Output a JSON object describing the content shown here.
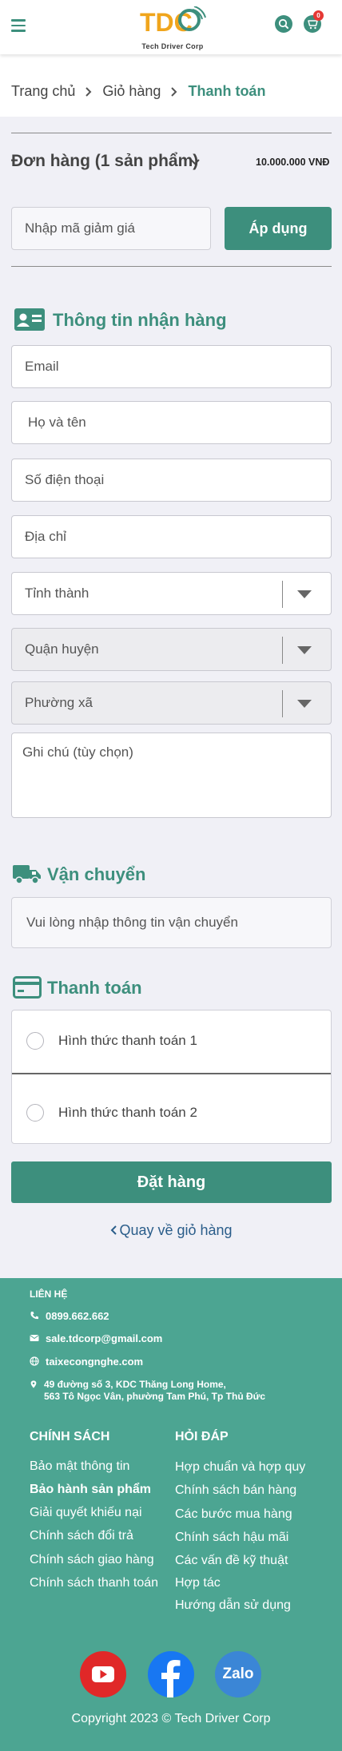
{
  "header": {
    "brand_text": "Tech Driver Corp",
    "logo_letters": "TDC",
    "cart_count": "0"
  },
  "breadcrumb": {
    "home": "Trang chủ",
    "cart": "Giỏ hàng",
    "current": "Thanh toán"
  },
  "order": {
    "title": "Đơn hàng (1 sản phẩm)",
    "total": "10.000.000 VNĐ"
  },
  "coupon": {
    "placeholder": "Nhập mã giảm giá",
    "apply_label": "Áp dụng"
  },
  "shipping_info": {
    "title": "Thông tin nhận hàng",
    "email_placeholder": "Email",
    "name_placeholder": "Họ và tên",
    "phone_placeholder": "Số điện thoại",
    "address_placeholder": "Địa chỉ",
    "province_placeholder": "Tỉnh thành",
    "district_placeholder": "Quận huyện",
    "ward_placeholder": "Phường xã",
    "note_placeholder": "Ghi chú (tùy chọn)"
  },
  "delivery": {
    "title": "Vận chuyển",
    "message": "Vui lòng nhập thông tin vận chuyển"
  },
  "payment": {
    "title": "Thanh toán",
    "options": [
      "Hình thức thanh toán 1",
      "Hình thức thanh toán 2"
    ]
  },
  "actions": {
    "place_order": "Đặt hàng",
    "back_to_cart": "Quay về giỏ hàng"
  },
  "footer": {
    "contact_title": "LIÊN HỆ",
    "phone": "0899.662.662",
    "email": "sale.tdcorp@gmail.com",
    "website": "taixecongnghe.com",
    "address_line1": "49 đường số 3, KDC Thăng Long Home,",
    "address_line2": "563 Tô Ngọc Vân, phường Tam Phú, Tp Thủ Đức",
    "policy_title": "CHÍNH SÁCH",
    "policy_links": [
      "Bảo mật thông tin",
      "Bảo hành sản phẩm",
      "Giải quyết khiếu nại",
      "Chính sách đổi trả",
      "Chính sách giao hàng",
      "Chính sách thanh toán"
    ],
    "faq_title": "HỎI ĐÁP",
    "faq_links": [
      "Hợp chuẩn và hợp quy",
      "Chính sách bán hàng",
      "Các bước mua hàng",
      "Chính sách hậu mãi",
      "Các vấn đề kỹ thuật",
      "Hợp tác",
      "Hướng dẫn sử dụng"
    ],
    "social": {
      "youtube_color": "#e02828",
      "facebook_color": "#1877f2",
      "zalo_color": "#3b86d6",
      "zalo_label": "Zalo"
    },
    "copyright": "Copyright 2023 © Tech Driver Corp"
  },
  "colors": {
    "accent": "#3d8f7d",
    "footer_bg": "#4ca592",
    "link": "#2a5d8a",
    "badge": "#e53935"
  }
}
